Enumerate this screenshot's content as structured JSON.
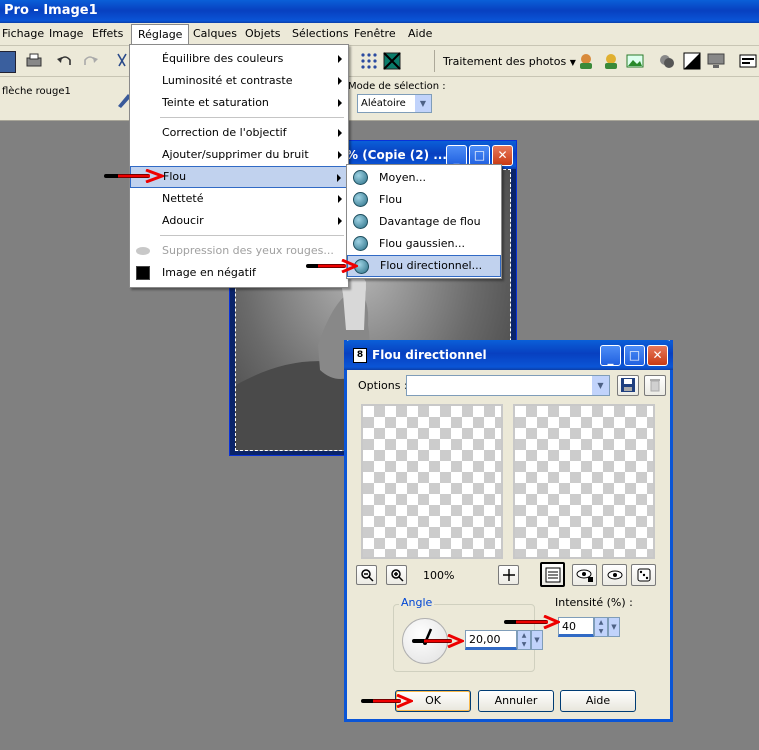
{
  "app": {
    "title": "Pro - Image1"
  },
  "menubar": [
    "Fichage",
    "Image",
    "Effets",
    "Réglage",
    "Calques",
    "Objets",
    "Sélections",
    "Fenêtre",
    "Aide"
  ],
  "toolbar": {
    "photo_dropdown": "Traitement des photos"
  },
  "toolbar2": {
    "layer_label": "flèche rouge1",
    "selection_mode_label": "Mode de sélection :",
    "selection_mode_value": "Aléatoire"
  },
  "reglage_menu": {
    "items": [
      {
        "label": "Équilibre des couleurs",
        "submenu": true
      },
      {
        "label": "Luminosité et contraste",
        "submenu": true
      },
      {
        "label": "Teinte et saturation",
        "submenu": true
      },
      {
        "label": "Correction de l'objectif",
        "submenu": true
      },
      {
        "label": "Ajouter/supprimer du bruit",
        "submenu": true
      },
      {
        "label": "Flou",
        "submenu": true,
        "highlighted": true
      },
      {
        "label": "Netteté",
        "submenu": true
      },
      {
        "label": "Adoucir",
        "submenu": true
      },
      {
        "label": "Suppression des yeux rouges...",
        "disabled": true
      },
      {
        "label": "Image en négatif"
      }
    ]
  },
  "flou_submenu": {
    "items": [
      "Moyen...",
      "Flou",
      "Davantage de flou",
      "Flou gaussien...",
      "Flou directionnel..."
    ]
  },
  "image_window": {
    "title": "% (Copie (2) ..."
  },
  "dialog": {
    "title": "Flou directionnel",
    "options_label": "Options :",
    "zoom": "100%",
    "angle_label": "Angle",
    "angle_value": "20,00",
    "intensity_label": "Intensité (%) :",
    "intensity_value": "40",
    "ok": "OK",
    "cancel": "Annuler",
    "help": "Aide"
  }
}
